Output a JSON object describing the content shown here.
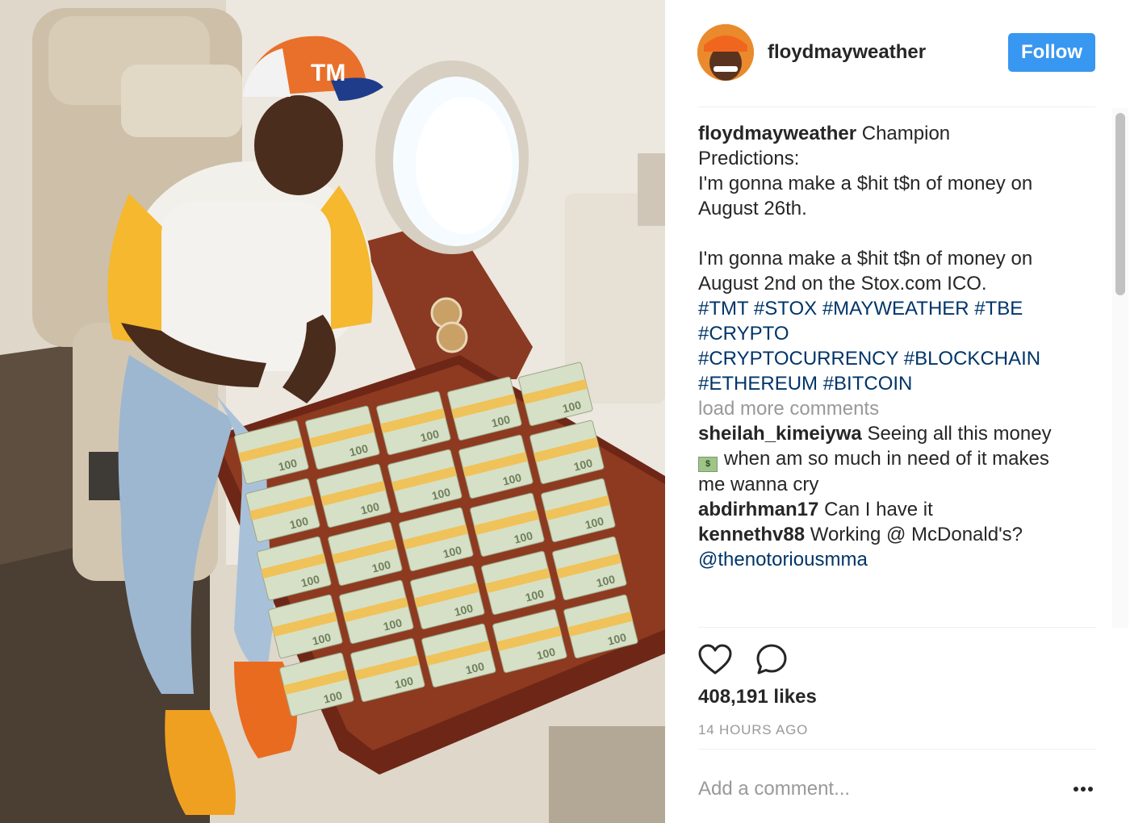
{
  "post": {
    "username": "floydmayweather",
    "follow_label": "Follow",
    "caption_lines": [
      "Champion",
      "Predictions:",
      "I'm gonna make a $hit t$n of money on",
      "August 26th.",
      "I'm gonna make a $hit t$n of money on",
      "August 2nd on the Stox.com ICO."
    ],
    "hashtag_lines": [
      "#TMT #STOX #MAYWEATHER #TBE",
      "#CRYPTO",
      "#CRYPTOCURRENCY #BLOCKCHAIN",
      "#ETHEREUM #BITCOIN"
    ],
    "load_more_label": "load more comments",
    "likes_text": "408,191 likes",
    "time_text": "14 HOURS AGO",
    "add_comment_placeholder": "Add a comment..."
  },
  "comments": [
    {
      "user": "sheilah_kimeiywa",
      "line1": "Seeing all this money",
      "emoji": "money-with-wings",
      "line2": "when am so much in need of it makes",
      "line3": "me wanna cry"
    },
    {
      "user": "abdirhman17",
      "text": "Can I have it"
    },
    {
      "user": "kennethv88",
      "text": "Working @ McDonald's?",
      "mention": "@thenotoriousmma"
    }
  ],
  "photo": {
    "cap_text": "TM",
    "bill_denomination": "100"
  },
  "icons": [
    "heart-icon",
    "comment-icon",
    "more-options-icon"
  ],
  "colors": {
    "follow": "#3897f0",
    "hashtag": "#003569",
    "muted": "#999999",
    "text": "#262626"
  }
}
